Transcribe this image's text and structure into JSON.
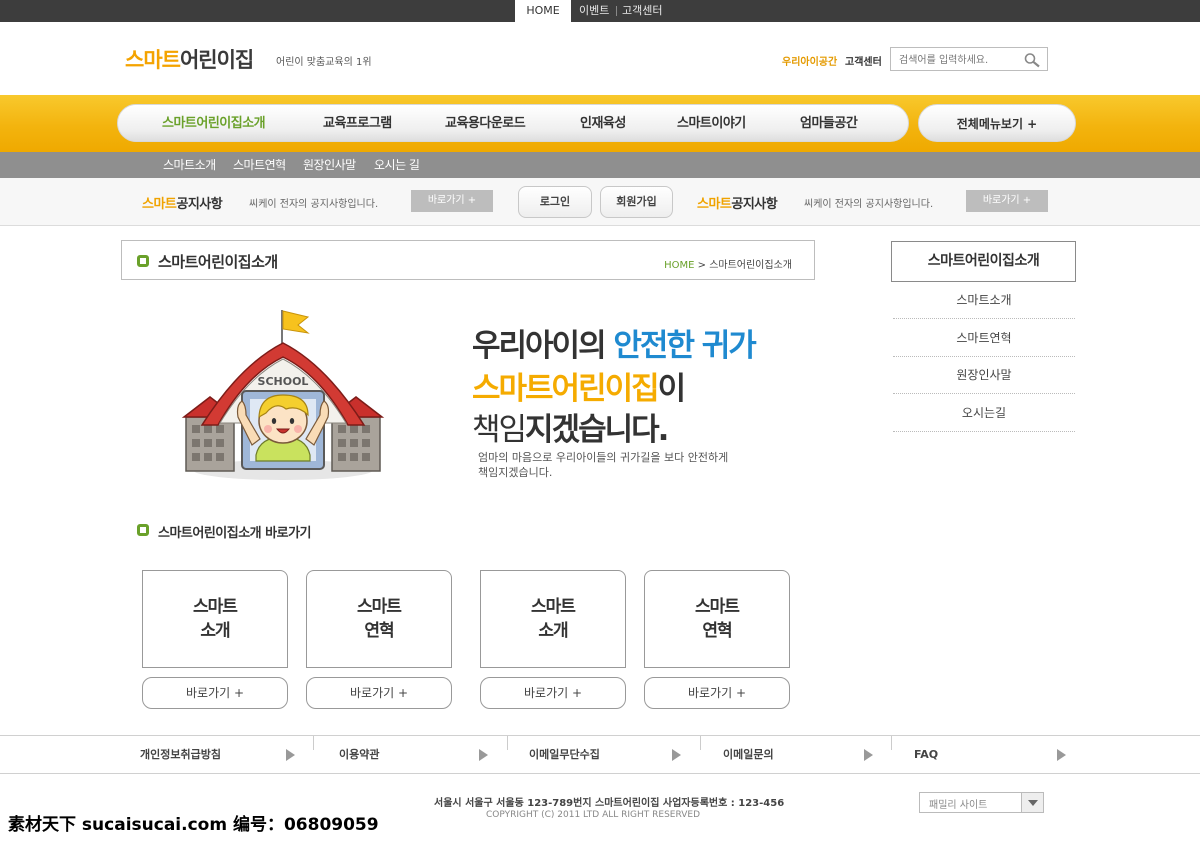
{
  "topbar": {
    "home": "HOME",
    "events": "이벤트",
    "support": "고객센터"
  },
  "header": {
    "logo_yellow": "스마트",
    "logo_dark": "어린이집",
    "tagline": "어린이 맞춤교육의 1위",
    "link_space": "우리아이공간",
    "link_support": "고객센터",
    "search_placeholder": "검색어를 입력하세요."
  },
  "nav": {
    "items": [
      {
        "label": "스마트어린이집소개"
      },
      {
        "label": "교육프로그램"
      },
      {
        "label": "교육용다운로드"
      },
      {
        "label": "인재육성"
      },
      {
        "label": "스마트이야기"
      },
      {
        "label": "엄마들공간"
      }
    ],
    "all_menu": "전체메뉴보기  +"
  },
  "subnav": {
    "items": [
      "스마트소개",
      "스마트연혁",
      "원장인사말",
      "오시는 길"
    ]
  },
  "notice": {
    "title_yellow": "스마트",
    "title_dark": "공지사항",
    "text": "씨케이 전자의 공지사항입니다.",
    "go": "바로가기  +",
    "login": "로그인",
    "join": "회원가입"
  },
  "page": {
    "title": "스마트어린이집소개",
    "breadcrumb_home": "HOME",
    "breadcrumb_current": "스마트어린이집소개"
  },
  "side": {
    "title": "스마트어린이집소개",
    "items": [
      "스마트소개",
      "스마트연혁",
      "원장인사말",
      "오시는길"
    ]
  },
  "hero": {
    "school_sign": "SCHOOL",
    "l1_dark": "우리아이의 ",
    "l1_blue": "안전한 귀가",
    "l2_yellow": "스마트어린이집",
    "l2_dark": "이",
    "l3_light": "책임",
    "l3_bold": "지겠습니다.",
    "desc1": "엄마의 마음으로 우리아이들의 귀가길을 보다 안전하게",
    "desc2": "책임지겠습니다."
  },
  "shortcut": {
    "title": "스마트어린이집소개 바로가기",
    "cards": [
      {
        "l1": "스마트",
        "l2": "소개",
        "btn": "바로가기 +"
      },
      {
        "l1": "스마트",
        "l2": "연혁",
        "btn": "바로가기 +"
      },
      {
        "l1": "스마트",
        "l2": "소개",
        "btn": "바로가기 +"
      },
      {
        "l1": "스마트",
        "l2": "연혁",
        "btn": "바로가기 +"
      }
    ]
  },
  "footer": {
    "links": [
      "개인정보취급방침",
      "이용약관",
      "이메일무단수집",
      "이메일문의",
      "FAQ"
    ],
    "address": "서울시 서울구 서울동 123-789번지 스마트어린이집 사업자등록번호 : 123-456",
    "copyright": "COPYRIGHT (C) 2011 LTD ALL RIGHT RESERVED",
    "family_site": "패밀리 사이트"
  },
  "watermark": "素材天下 sucaisucai.com   编号：06809059",
  "colors": {
    "accent_yellow": "#f4a300",
    "accent_green": "#6aa12a",
    "accent_blue": "#1f8ad0"
  }
}
